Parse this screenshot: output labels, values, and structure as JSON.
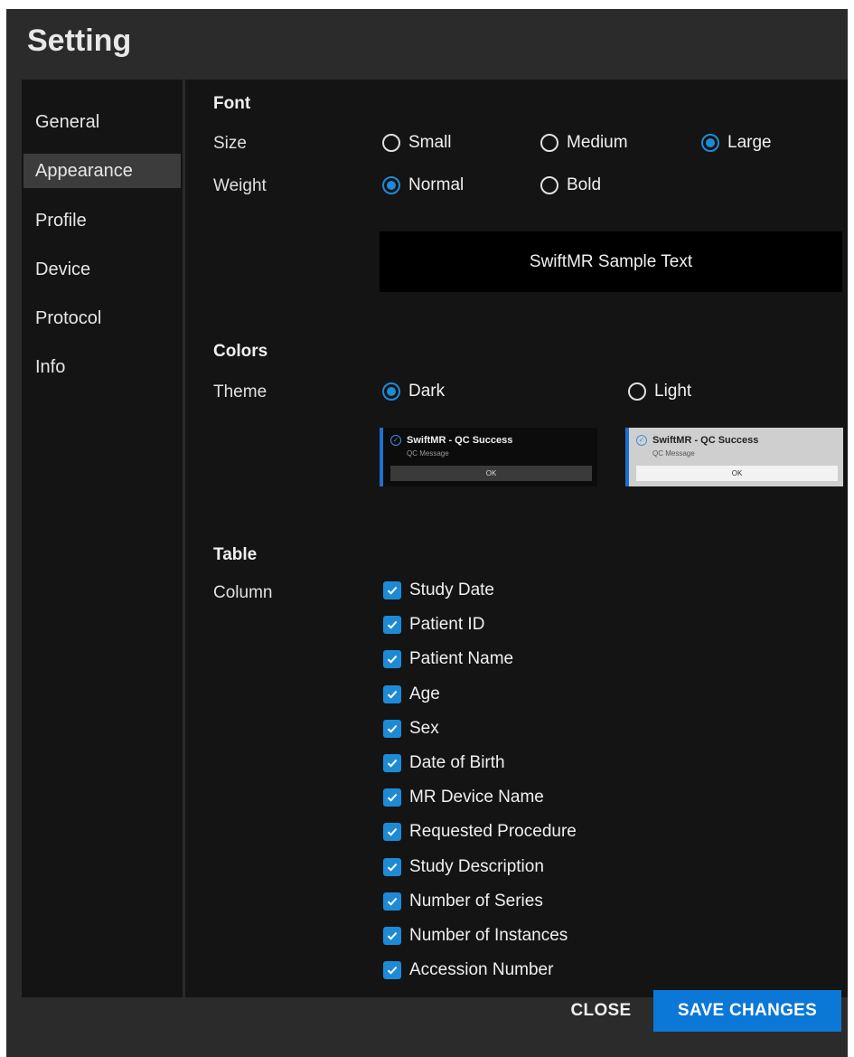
{
  "dialog": {
    "title": "Setting",
    "close_label": "CLOSE",
    "save_label": "SAVE CHANGES"
  },
  "sidebar": {
    "items": [
      {
        "label": "General",
        "active": false
      },
      {
        "label": "Appearance",
        "active": true
      },
      {
        "label": "Profile",
        "active": false
      },
      {
        "label": "Device",
        "active": false
      },
      {
        "label": "Protocol",
        "active": false
      },
      {
        "label": "Info",
        "active": false
      }
    ]
  },
  "font": {
    "title": "Font",
    "size_label": "Size",
    "size_options": [
      {
        "label": "Small",
        "checked": false
      },
      {
        "label": "Medium",
        "checked": false
      },
      {
        "label": "Large",
        "checked": true
      }
    ],
    "weight_label": "Weight",
    "weight_options": [
      {
        "label": "Normal",
        "checked": true
      },
      {
        "label": "Bold",
        "checked": false
      }
    ],
    "sample_text": "SwiftMR Sample Text"
  },
  "colors": {
    "title": "Colors",
    "theme_label": "Theme",
    "theme_options": [
      {
        "label": "Dark",
        "checked": true
      },
      {
        "label": "Light",
        "checked": false
      }
    ],
    "preview": {
      "title": "SwiftMR - QC Success",
      "message": "QC Message",
      "ok": "OK"
    }
  },
  "table": {
    "title": "Table",
    "column_label": "Column",
    "columns": [
      {
        "label": "Study Date",
        "checked": true
      },
      {
        "label": "Patient ID",
        "checked": true
      },
      {
        "label": "Patient Name",
        "checked": true
      },
      {
        "label": "Age",
        "checked": true
      },
      {
        "label": "Sex",
        "checked": true
      },
      {
        "label": "Date of Birth",
        "checked": true
      },
      {
        "label": "MR Device Name",
        "checked": true
      },
      {
        "label": "Requested Procedure",
        "checked": true
      },
      {
        "label": "Study Description",
        "checked": true
      },
      {
        "label": "Number of Series",
        "checked": true
      },
      {
        "label": "Number of Instances",
        "checked": true
      },
      {
        "label": "Accession Number",
        "checked": true
      }
    ]
  },
  "colors_palette": {
    "accent": "#1e8ad6",
    "save_button": "#0b78d7",
    "dialog_bg": "#2b2b2b",
    "panel_bg": "#141414"
  }
}
